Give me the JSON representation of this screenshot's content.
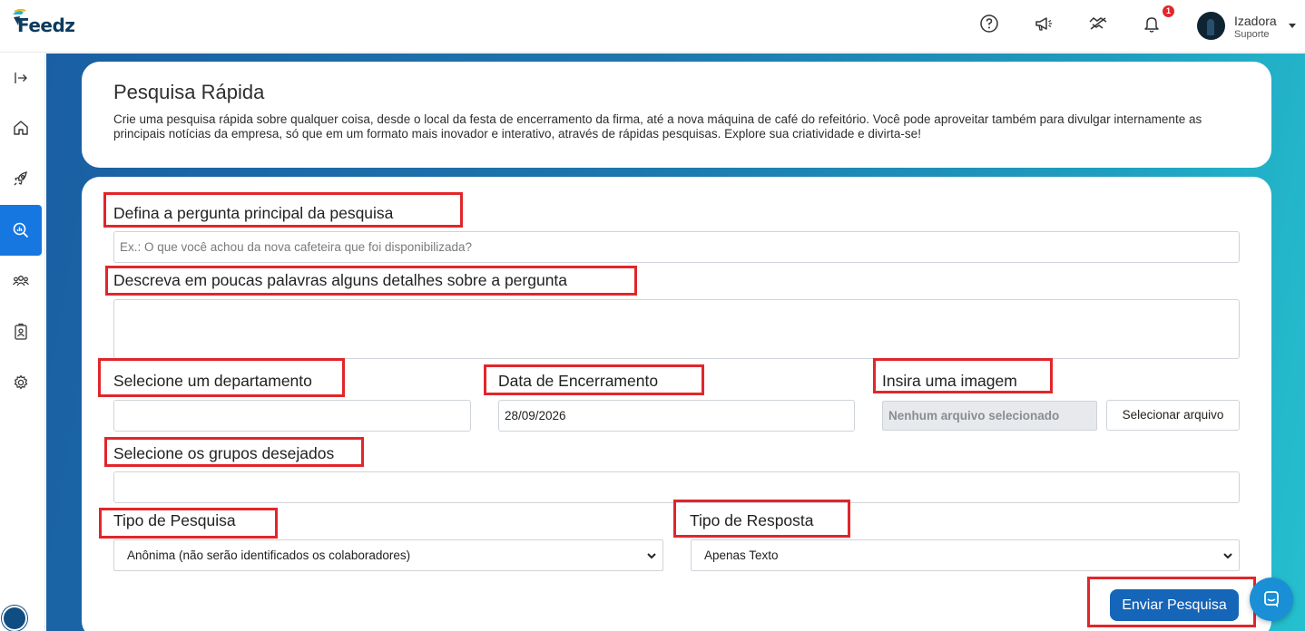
{
  "app": {
    "logo_text": "Feedz",
    "accent_color": "#1677e0",
    "highlight_color": "#e1262b"
  },
  "header": {
    "icons": [
      "help-circle-icon",
      "megaphone-icon",
      "handshake-icon",
      "bell-icon"
    ],
    "notification_count": "1",
    "user": {
      "name": "Izadora",
      "role": "Suporte"
    }
  },
  "sidebar": {
    "items": [
      {
        "icon": "expand-arrow-icon"
      },
      {
        "icon": "home-icon"
      },
      {
        "icon": "rocket-icon"
      },
      {
        "icon": "search-chart-icon",
        "active": true
      },
      {
        "icon": "people-icon"
      },
      {
        "icon": "badge-icon"
      },
      {
        "icon": "gear-icon"
      }
    ]
  },
  "page": {
    "title": "Pesquisa Rápida",
    "description": "Crie uma pesquisa rápida sobre qualquer coisa, desde o local da festa de encerramento da firma, até a nova máquina de café do refeitório. Você pode aproveitar também para divulgar internamente as principais notícias da empresa, só que em um formato mais inovador e interativo, através de rápidas pesquisas. Explore sua criatividade e divirta-se!"
  },
  "form": {
    "question": {
      "label": "Defina a pergunta principal da pesquisa",
      "placeholder": "Ex.: O que você achou da nova cafeteira que foi disponibilizada?"
    },
    "details": {
      "label": "Descreva em poucas palavras alguns detalhes sobre a pergunta",
      "value": ""
    },
    "department": {
      "label": "Selecione um departamento",
      "value": ""
    },
    "end_date": {
      "label": "Data de Encerramento",
      "value": "28/09/2026"
    },
    "image": {
      "label": "Insira uma imagem",
      "file_status": "Nenhum arquivo selecionado",
      "button_label": "Selecionar arquivo"
    },
    "groups": {
      "label": "Selecione os grupos desejados",
      "value": ""
    },
    "survey_type": {
      "label": "Tipo de Pesquisa",
      "selected": "Anônima (não serão identificados os colaboradores)"
    },
    "response_type": {
      "label": "Tipo de Resposta",
      "selected": "Apenas Texto"
    },
    "submit_label": "Enviar Pesquisa"
  }
}
